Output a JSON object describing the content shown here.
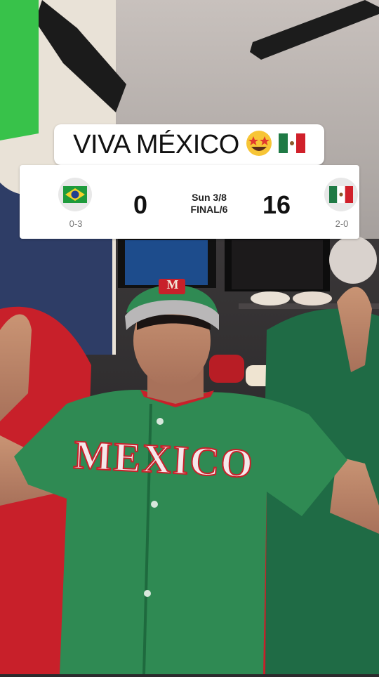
{
  "overlay": {
    "title": "VIVA MÉXICO",
    "title_emojis": [
      "star-struck-emoji",
      "mexico-flag-emoji"
    ]
  },
  "scoreboard": {
    "away": {
      "team_flag": "brazil-flag-icon",
      "score": "0",
      "record": "0-3"
    },
    "home": {
      "team_flag": "mexico-flag-icon",
      "score": "16",
      "record": "2-0"
    },
    "status_line1": "Sun 3/8",
    "status_line2": "FINAL/6"
  },
  "jersey_text": "MEXICO",
  "cap_logo": "M",
  "colors": {
    "jersey_green": "#2f8a53",
    "flag_red": "#c8202a",
    "flag_green": "#1f6b45",
    "card_bg": "#ffffff"
  }
}
